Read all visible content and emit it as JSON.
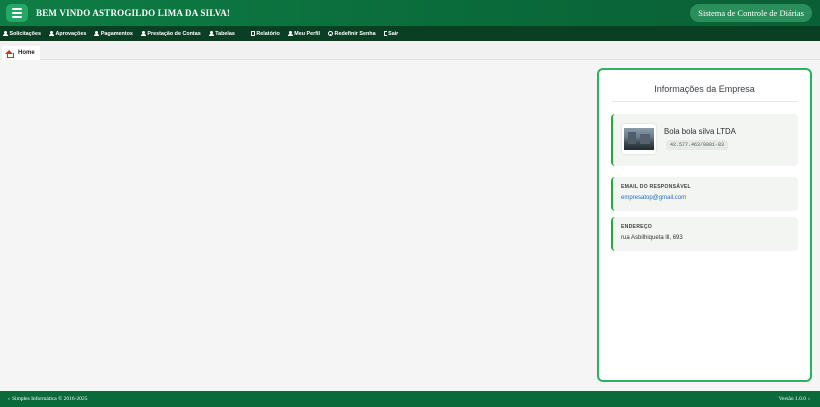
{
  "header": {
    "welcome": "BEM VINDO ASTROGILDO LIMA DA SILVA!",
    "system": "Sistema de Controle de Diárias"
  },
  "nav": {
    "items": [
      {
        "label": "Solicitações",
        "icon": "user-icon"
      },
      {
        "label": "Aprovações",
        "icon": "user-icon"
      },
      {
        "label": "Pagamentos",
        "icon": "user-icon"
      },
      {
        "label": "Prestação de Contas",
        "icon": "user-icon"
      },
      {
        "label": "Tabelas",
        "icon": "user-icon"
      },
      {
        "label": "Relatório",
        "icon": "document-icon"
      },
      {
        "label": "Meu Perfil",
        "icon": "user-icon"
      },
      {
        "label": "Redefinir Senha",
        "icon": "key-icon"
      },
      {
        "label": "Sair",
        "icon": "exit-icon"
      }
    ]
  },
  "tab": {
    "label": "Home"
  },
  "company": {
    "title": "Informações da Empresa",
    "name": "Bola bola silva LTDA",
    "cnpj": "42.577.463/0001-83",
    "email_label": "EMAIL DO RESPONSÁVEL",
    "email": "empresatop@gmail.com",
    "address_label": "ENDEREÇO",
    "address": "rua Asbilhiqueta lll, 693"
  },
  "footer": {
    "left": "Simples Informática © 2016-2025",
    "right": "Versão 1.0.0"
  },
  "colors": {
    "brand_green": "#0e7d45",
    "nav_dark": "#0a3f24",
    "accent": "#28b463"
  }
}
